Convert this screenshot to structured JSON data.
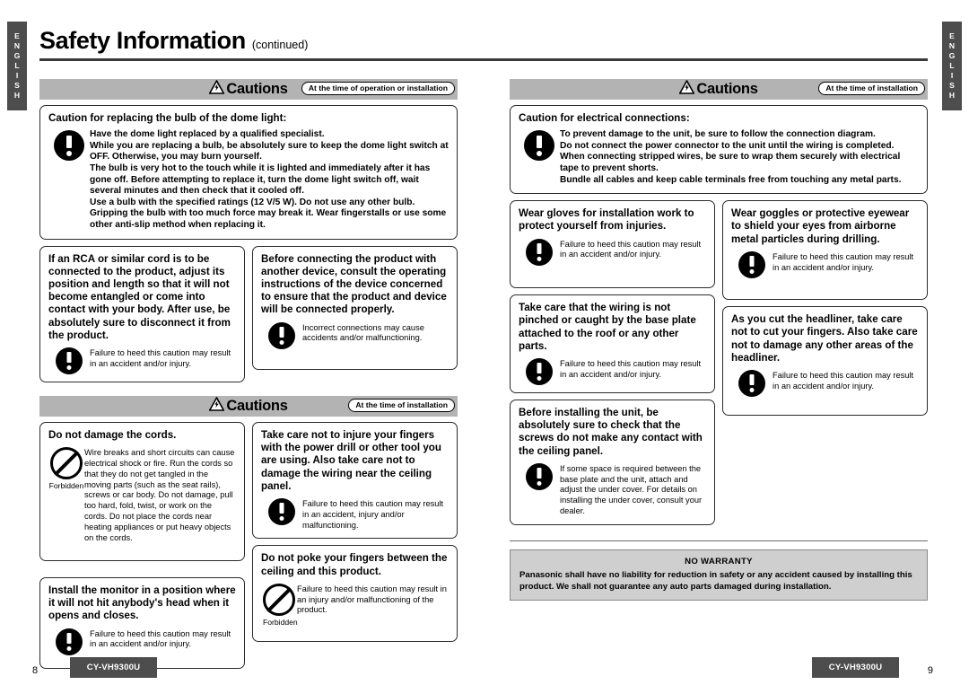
{
  "document": {
    "title": "Safety Information",
    "title_suffix": "(continued)",
    "language_tab": "ENGLISH"
  },
  "left_page": {
    "page_number": "8",
    "model": "CY-VH9300U",
    "sections": [
      {
        "header": {
          "label": "Cautions",
          "icon": "warning-triangle-icon",
          "time_pill": "At the time of operation or installation"
        },
        "boxes": [
          {
            "title": "Caution for replacing the bulb of the dome light:",
            "icon": "exclamation-circle-icon",
            "icon_label": "",
            "bullets": [
              "Have the dome light replaced by a qualified specialist.",
              "While you are replacing a bulb, be absolutely sure to keep the dome light switch at OFF. Otherwise, you may burn yourself.",
              "The bulb is very hot to the touch while it is lighted and immediately after it has gone off. Before attempting to replace it, turn the dome light switch off, wait several minutes and then check that it cooled off.",
              "Use a bulb with the specified ratings (12 V/5 W). Do not use any other bulb.",
              "Gripping the bulb with too much force may break it. Wear fingerstalls or use some other anti-slip method when replacing it."
            ]
          },
          {
            "title": "If an RCA or similar cord is to be connected to the product, adjust its position and length so that it will not become entangled or come into contact with your body. After use, be absolutely sure to disconnect it from the product.",
            "icon": "exclamation-circle-icon",
            "icon_label": "",
            "note": "Failure to heed this caution may result in an accident and/or injury."
          },
          {
            "title": "Before connecting the product with another device, consult the operating instructions of the device concerned to ensure that the product and device will be connected properly.",
            "icon": "exclamation-circle-icon",
            "icon_label": "",
            "note": "Incorrect connections may cause accidents and/or malfunctioning."
          }
        ]
      },
      {
        "header": {
          "label": "Cautions",
          "icon": "warning-triangle-icon",
          "time_pill": "At the time of installation"
        },
        "boxes": [
          {
            "title": "Do not damage the cords.",
            "icon": "forbidden-icon",
            "icon_label": "Forbidden",
            "note": "Wire breaks and short circuits can cause electrical shock or fire. Run the cords so that they do not get tangled in the moving parts (such as the seat rails), screws or car body. Do not damage, pull too hard, fold, twist, or work on the cords. Do not place the cords near heating appliances or put heavy objects on the cords."
          },
          {
            "title": "Take care not to injure your fingers with the power drill or other tool you are using. Also take care not to damage the wiring near the ceiling panel.",
            "icon": "exclamation-circle-icon",
            "icon_label": "",
            "note": "Failure to heed this caution may result in an accident, injury and/or malfunctioning."
          },
          {
            "title": "Do not poke your fingers between the ceiling and this product.",
            "icon": "forbidden-icon",
            "icon_label": "Forbidden",
            "note": "Failure to heed this caution may result in an injury and/or malfunctioning of the product."
          },
          {
            "title": "Install the monitor in a position where it will not hit anybody's head when it opens and closes.",
            "icon": "exclamation-circle-icon",
            "icon_label": "",
            "note": "Failure to heed this caution may result in an accident and/or injury."
          }
        ]
      }
    ]
  },
  "right_page": {
    "page_number": "9",
    "model": "CY-VH9300U",
    "header": {
      "label": "Cautions",
      "icon": "warning-triangle-icon",
      "time_pill": "At the time of installation"
    },
    "boxes": [
      {
        "title": "Caution for electrical connections:",
        "icon": "exclamation-circle-icon",
        "bullets": [
          "To prevent damage to the unit, be sure to follow the connection diagram.",
          "Do not connect the power connector to the unit until the wiring is completed.",
          "When connecting stripped wires, be sure to wrap them securely with electrical tape to prevent shorts.",
          "Bundle all cables and keep cable terminals free from touching any metal parts."
        ]
      },
      {
        "title": "Wear gloves for installation work to protect yourself from injuries.",
        "icon": "exclamation-circle-icon",
        "note": "Failure to heed this caution may result in an accident and/or injury."
      },
      {
        "title": "Wear goggles or protective eyewear to shield your eyes from airborne metal particles during drilling.",
        "icon": "exclamation-circle-icon",
        "note": "Failure to heed this caution may result in an accident and/or injury."
      },
      {
        "title": "Take care that the wiring is not pinched or caught by the base plate attached to the roof or any other parts.",
        "icon": "exclamation-circle-icon",
        "note": "Failure to heed this caution may result in an accident and/or injury."
      },
      {
        "title": "As you cut the headliner, take care not to cut your fingers. Also take care not to damage any other areas of the headliner.",
        "icon": "exclamation-circle-icon",
        "note": "Failure to heed this caution may result in an accident and/or injury."
      },
      {
        "title": "Before installing the unit, be absolutely sure to check that the screws do not make any contact with the ceiling panel.",
        "icon": "exclamation-circle-icon",
        "note": "If some space is required between the base plate and the unit, attach and adjust the under cover. For details on installing the under cover, consult your dealer."
      }
    ],
    "no_warranty": {
      "title": "NO WARRANTY",
      "text": "Panasonic shall have no liability for reduction in safety or any accident caused by installing this product. We shall not guarantee any auto parts damaged during installation."
    }
  },
  "colors": {
    "bar_gray": "#b3b3b3",
    "tab_gray": "#4d4d4d",
    "warranty_gray": "#cfcfcf",
    "rule_dark": "#3a3a3a"
  }
}
